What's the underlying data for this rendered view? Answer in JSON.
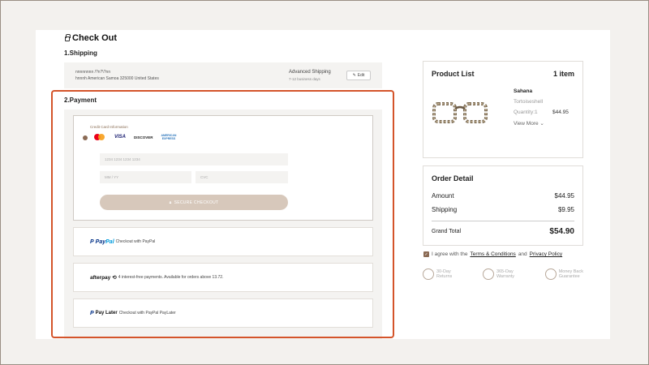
{
  "page": {
    "title": "Check Out"
  },
  "shipping": {
    "heading": "1.Shipping",
    "name": "nnnnnnnn /?n?\\?nn",
    "address": "hnnnh American Samoa 325000 United States",
    "method": "Advanced Shipping",
    "days": "7-12 business days",
    "edit_label": "Edit"
  },
  "payment": {
    "heading": "2.Payment",
    "card_info_label": "Credit Card Information",
    "card_brands": [
      "mastercard",
      "VISA",
      "DISCOVER",
      "AMERICAN EXPRESS"
    ],
    "card_number_placeholder": "1234 1234 1234 1234",
    "expiry_placeholder": "MM / YY",
    "cvc_placeholder": "CVC",
    "secure_checkout_label": "SECURE CHECKOUT",
    "paypal": {
      "logo_a": "Pay",
      "logo_b": "Pal",
      "text": "Checkout with PayPal"
    },
    "afterpay": {
      "logo": "afterpay",
      "text": "4 interest-free payments. Available for orders above 13.72."
    },
    "paylater": {
      "logo": "Pay Later",
      "text": "Checkout with PayPal PayLater"
    }
  },
  "product_list": {
    "title": "Product List",
    "count": "1 item",
    "product": {
      "name": "Sahana",
      "color": "Tortoiseshell",
      "quantity": "Quantity:1",
      "price": "$44.95",
      "view_more": "View More"
    }
  },
  "order_detail": {
    "title": "Order Detail",
    "amount_label": "Amount",
    "amount_value": "$44.95",
    "shipping_label": "Shipping",
    "shipping_value": "$9.95",
    "total_label": "Grand Total",
    "total_value": "$54.90"
  },
  "agreement": {
    "prefix": "I agree with the",
    "terms": "Terms & Conditions",
    "and": "and",
    "privacy": "Privacy Policy"
  },
  "badges": [
    {
      "line1": "30-Day",
      "line2": "Returns"
    },
    {
      "line1": "365-Day",
      "line2": "Warranty"
    },
    {
      "line1": "Money Back",
      "line2": "Guarantee"
    }
  ],
  "colors": {
    "accent": "#8b6b55",
    "highlight": "#d4542a",
    "button": "#d7c8bb"
  }
}
